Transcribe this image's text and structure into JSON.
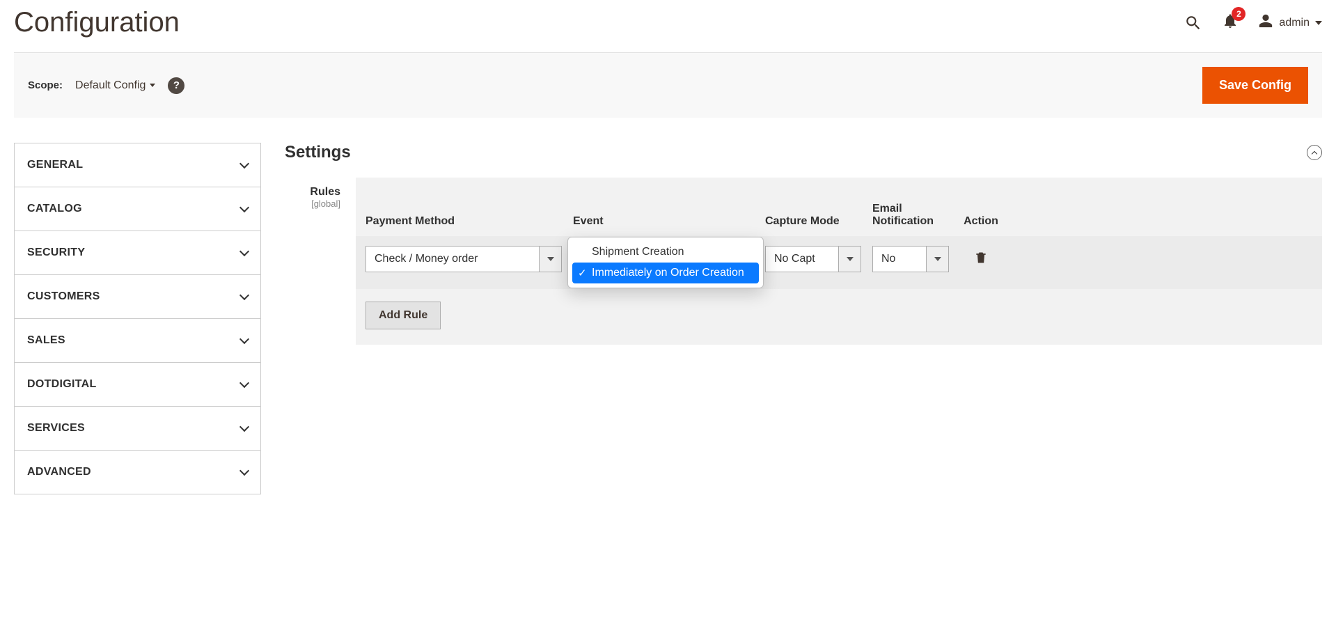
{
  "header": {
    "title": "Configuration",
    "notifications_count": "2",
    "username": "admin"
  },
  "toolbar": {
    "scope_label": "Scope:",
    "scope_value": "Default Config",
    "save_label": "Save Config"
  },
  "sidebar": {
    "items": [
      {
        "label": "GENERAL"
      },
      {
        "label": "CATALOG"
      },
      {
        "label": "SECURITY"
      },
      {
        "label": "CUSTOMERS"
      },
      {
        "label": "SALES"
      },
      {
        "label": "DOTDIGITAL"
      },
      {
        "label": "SERVICES"
      },
      {
        "label": "ADVANCED"
      }
    ]
  },
  "section": {
    "title": "Settings",
    "rules_label": "Rules",
    "rules_scope": "[global]",
    "columns": {
      "payment_method": "Payment Method",
      "event": "Event",
      "capture_mode": "Capture Mode",
      "email_notification": "Email Notification",
      "action": "Action"
    },
    "row": {
      "payment_method": "Check / Money order",
      "event_options": [
        "Shipment Creation",
        "Immediately on Order Creation"
      ],
      "event_selected_index": 1,
      "capture_mode": "No Capt",
      "email_notification": "No"
    },
    "add_rule": "Add Rule"
  }
}
